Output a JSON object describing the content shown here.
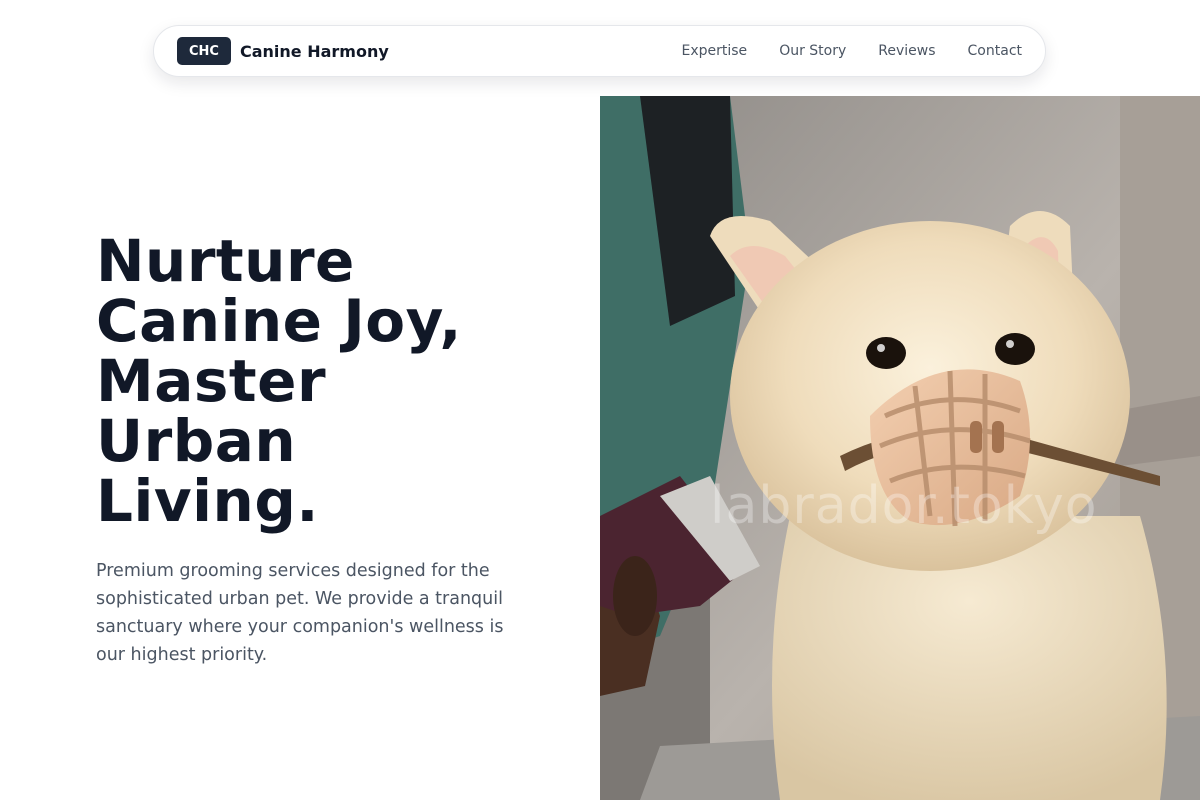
{
  "brand": {
    "badge": "CHC",
    "name": "Canine Harmony"
  },
  "nav": {
    "links": [
      {
        "label": "Expertise"
      },
      {
        "label": "Our Story"
      },
      {
        "label": "Reviews"
      },
      {
        "label": "Contact"
      }
    ]
  },
  "hero": {
    "title_lines": [
      "Nurture",
      "Canine Joy,",
      "Master",
      "Urban",
      "Living."
    ],
    "subtitle": "Premium grooming services designed for the sophisticated urban pet. We provide a tranquil sanctuary where your companion's wellness is our highest priority.",
    "image": {
      "watermark": "labrador.tokyo"
    }
  },
  "colors": {
    "primary_dark": "#111827",
    "badge_bg": "#1e293b",
    "body_text": "#4b5563",
    "nav_text": "#4b5563"
  }
}
